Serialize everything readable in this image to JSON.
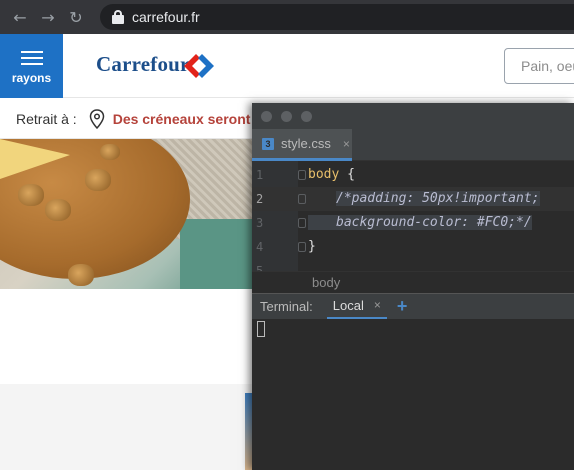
{
  "browser": {
    "back_glyph": "←",
    "forward_glyph": "→",
    "reload_glyph": "↻",
    "url": "carrefour.fr"
  },
  "header": {
    "rayons_label": "rayons",
    "brand_name": "Carrefour",
    "search_placeholder": "Pain, oeufs",
    "brand_colors": {
      "blue": "#1e71c5",
      "red": "#e2231a"
    }
  },
  "retrait": {
    "label": "Retrait à :",
    "creneaux_text": "Des créneaux seront"
  },
  "ide": {
    "tab_label": "style.css",
    "tab_icon": "css-file-icon",
    "close_glyph": "×",
    "lines": [
      {
        "num": "1",
        "selector": "body",
        "brace": " {"
      },
      {
        "num": "2",
        "code": "/*padding: 50px!important;"
      },
      {
        "num": "3",
        "code": "background-color: #FC0;*/"
      },
      {
        "num": "4",
        "brace": "}"
      },
      {
        "num": "5"
      }
    ],
    "breadcrumb": "body",
    "terminal": {
      "title": "Terminal:",
      "tab": "Local",
      "add_glyph": "+"
    }
  }
}
